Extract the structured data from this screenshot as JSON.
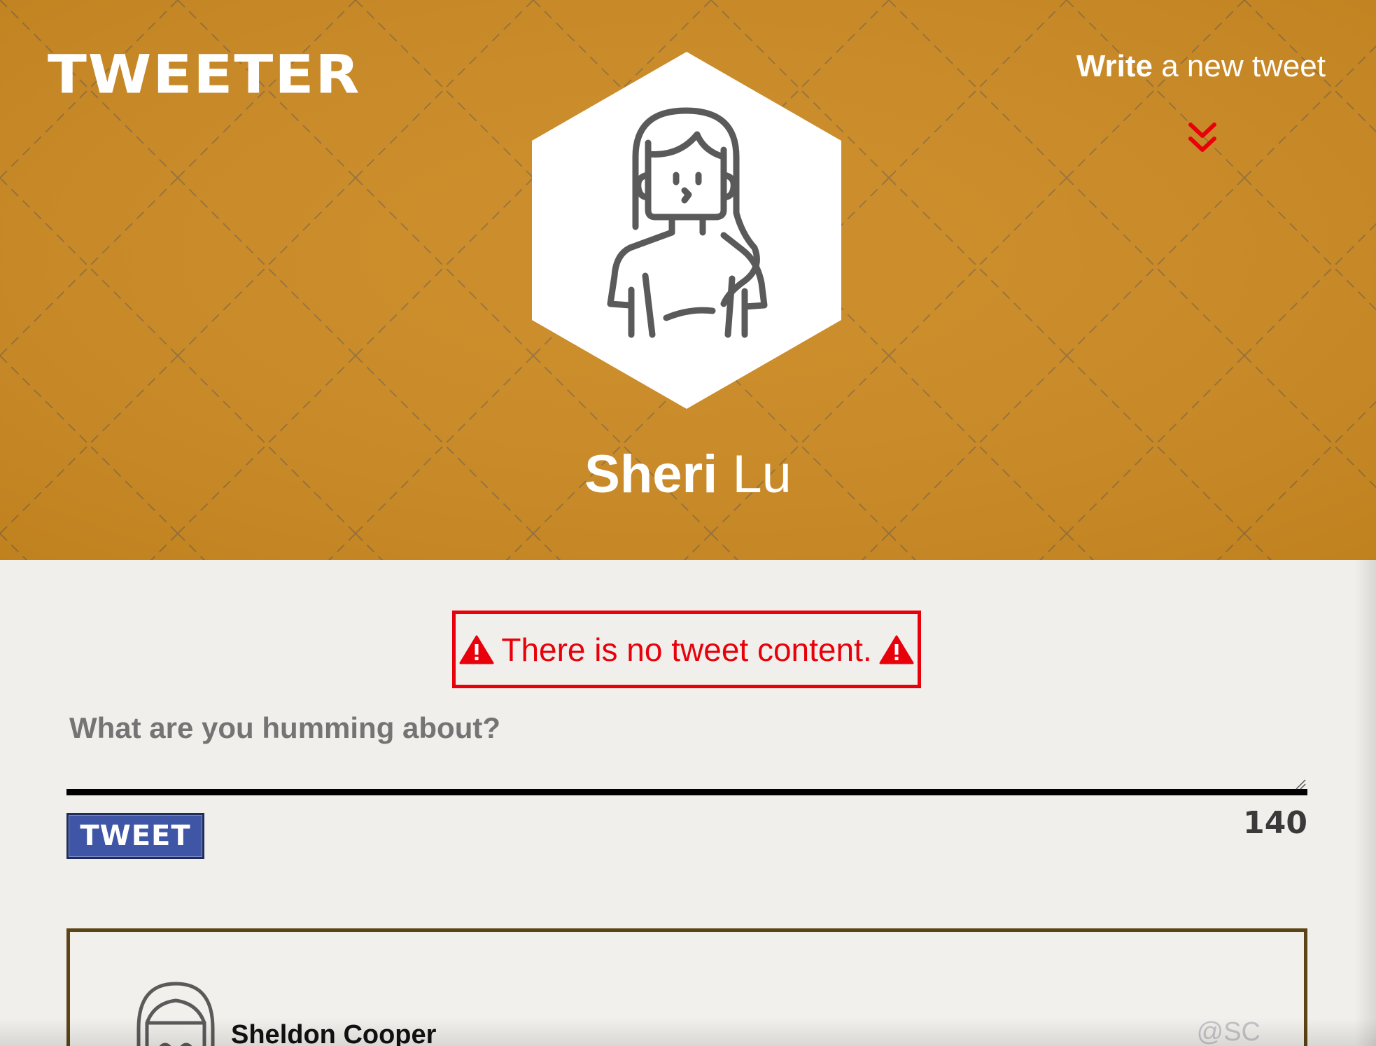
{
  "header": {
    "logo": "TWEETER",
    "write_strong": "Write",
    "write_rest": " a new tweet",
    "expand_icon": "double-chevron-down-icon"
  },
  "profile": {
    "first_name": "Sheri",
    "last_name": "Lu",
    "avatar_icon": "woman-avatar-icon"
  },
  "error": {
    "message": "There is no tweet content.",
    "icon": "warning-icon"
  },
  "compose": {
    "placeholder": "What are you humming about?",
    "value": "",
    "button_label": "TWEET",
    "char_count": "140"
  },
  "feed": [
    {
      "author": "Sheldon Cooper",
      "handle": "@SC",
      "avatar_icon": "man-avatar-icon"
    }
  ],
  "colors": {
    "header_bg": "#cb8922",
    "error": "#e8000b",
    "button_bg": "#3f56a6",
    "card_border": "#5b4516",
    "page_bg": "#f0efeb"
  }
}
